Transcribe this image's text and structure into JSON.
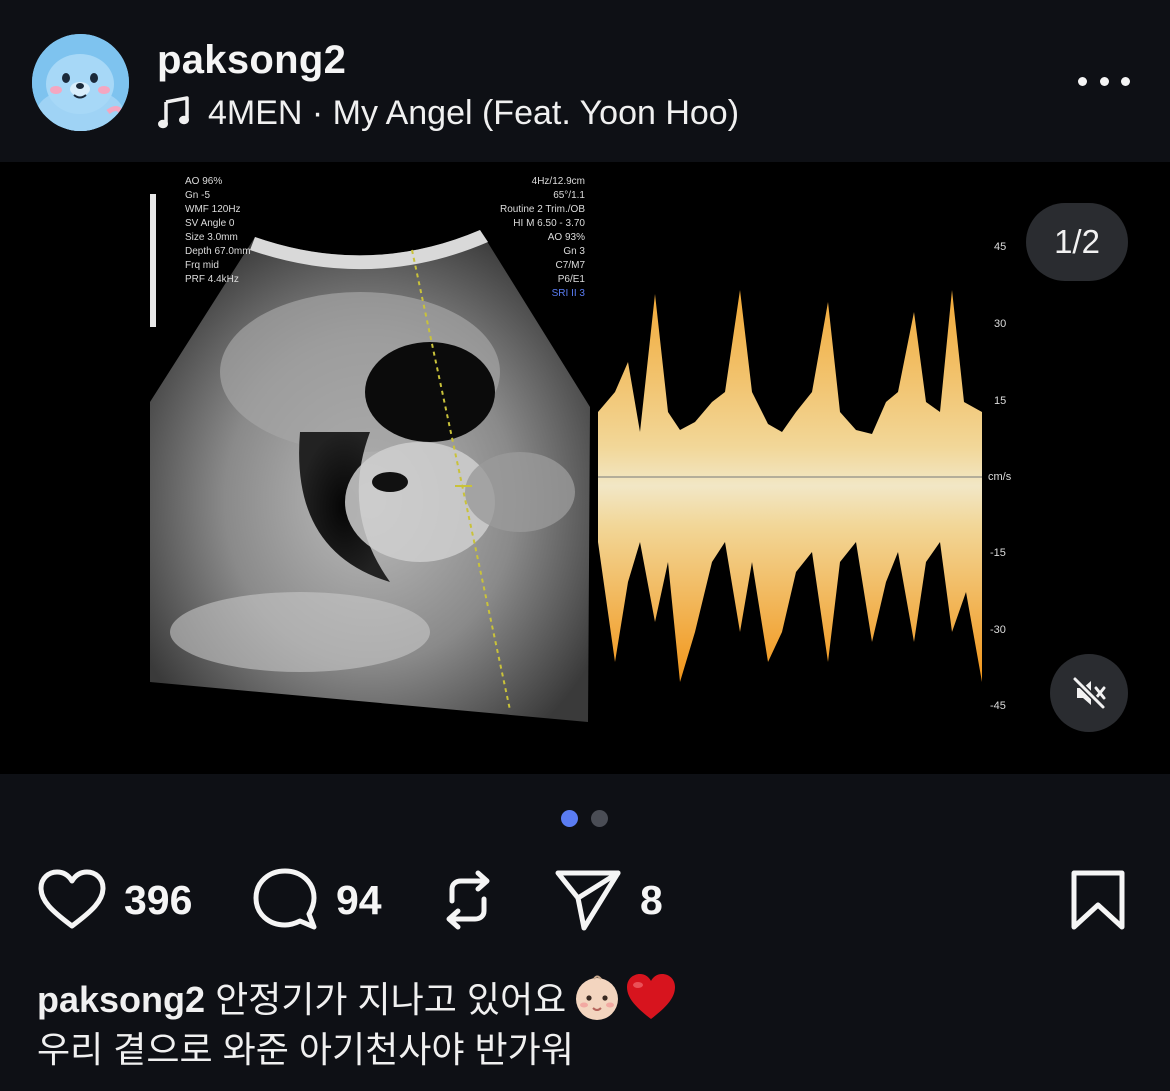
{
  "header": {
    "username": "paksong2",
    "music": "4MEN · My Angel (Feat. Yoon Hoo)",
    "avatar_icon": "seal-avatar",
    "more_icon": "more-icon"
  },
  "media": {
    "pager": "1/2",
    "mute_icon": "speaker-muted-icon",
    "image_desc_icon": "ultrasound-image",
    "overlay_left": [
      "AO 96%",
      "Gn -5",
      "WMF 120Hz",
      "SV Angle 0",
      "Size 3.0mm",
      "Depth 67.0mm",
      "Frq mid",
      "PRF 4.4kHz"
    ],
    "overlay_mid": [
      "4Hz/12.9cm",
      "65°/1.1",
      "Routine 2 Trim./OB",
      "HI M 6.50 - 3.70",
      "AO 93%",
      "Gn 3",
      "C7/M7",
      "P6/E1",
      "SRI II 3"
    ],
    "scale_ticks": [
      "45",
      "30",
      "15",
      "cm/s",
      "-15",
      "-30",
      "-45"
    ]
  },
  "carousel": {
    "total": 2,
    "active": 0
  },
  "actions": {
    "likes": "396",
    "comments": "94",
    "shares": "8"
  },
  "caption": {
    "username": "paksong2",
    "line1": "안정기가 지나고 있어요",
    "line2": "우리 곁으로 와준 아기천사야 반가워"
  },
  "colors": {
    "background": "#0e1015",
    "accent_dot": "#5a7cf2",
    "heart": "#d7141e",
    "doppler": "#ffd27a"
  }
}
